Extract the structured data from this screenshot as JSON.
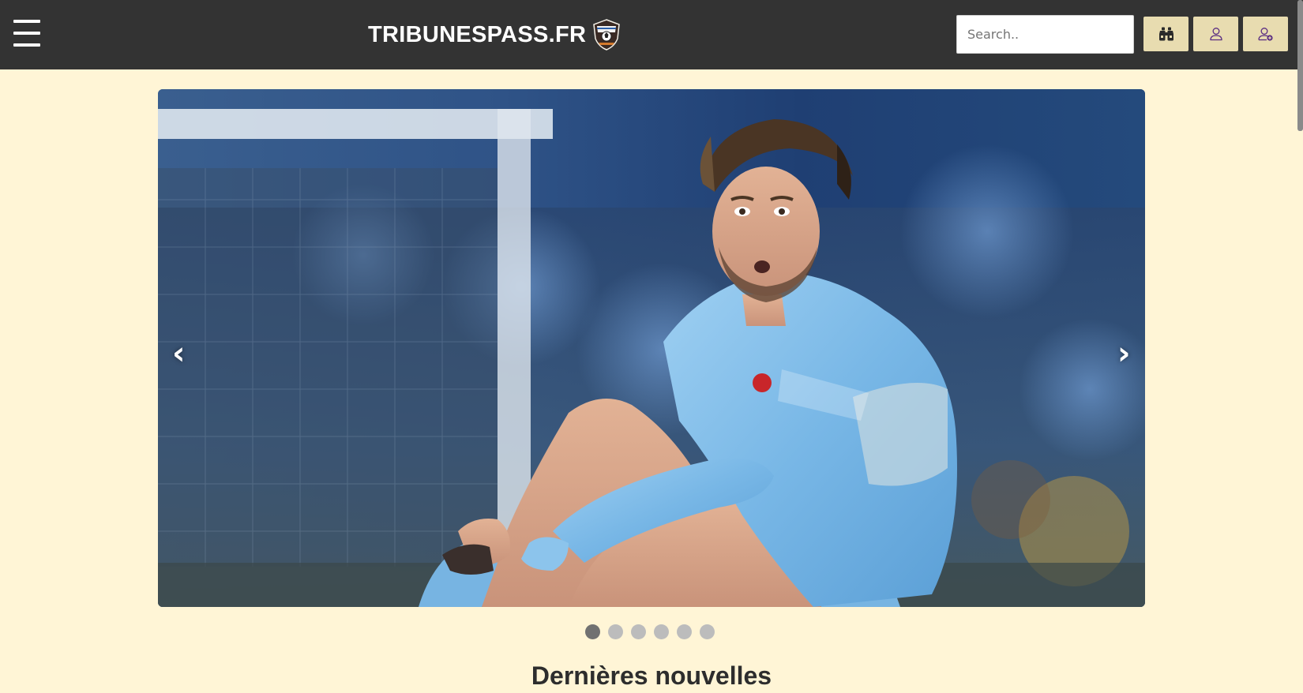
{
  "header": {
    "brand": "TRIBUNESPASS.FR",
    "search": {
      "placeholder": "Search..",
      "value": ""
    },
    "buttons": [
      {
        "icon": "binoculars-icon"
      },
      {
        "icon": "user-icon"
      },
      {
        "icon": "user-add-icon"
      }
    ]
  },
  "carousel": {
    "prev_label": "‹",
    "next_label": "›",
    "slide_count": 6,
    "active_slide": 1
  },
  "section": {
    "title": "Dernières nouvelles"
  },
  "colors": {
    "topbar": "#333333",
    "page_background": "#fff5d6",
    "button_background": "#e8dcb0",
    "dot_active": "#717171",
    "dot_inactive": "#bcbcbc"
  }
}
